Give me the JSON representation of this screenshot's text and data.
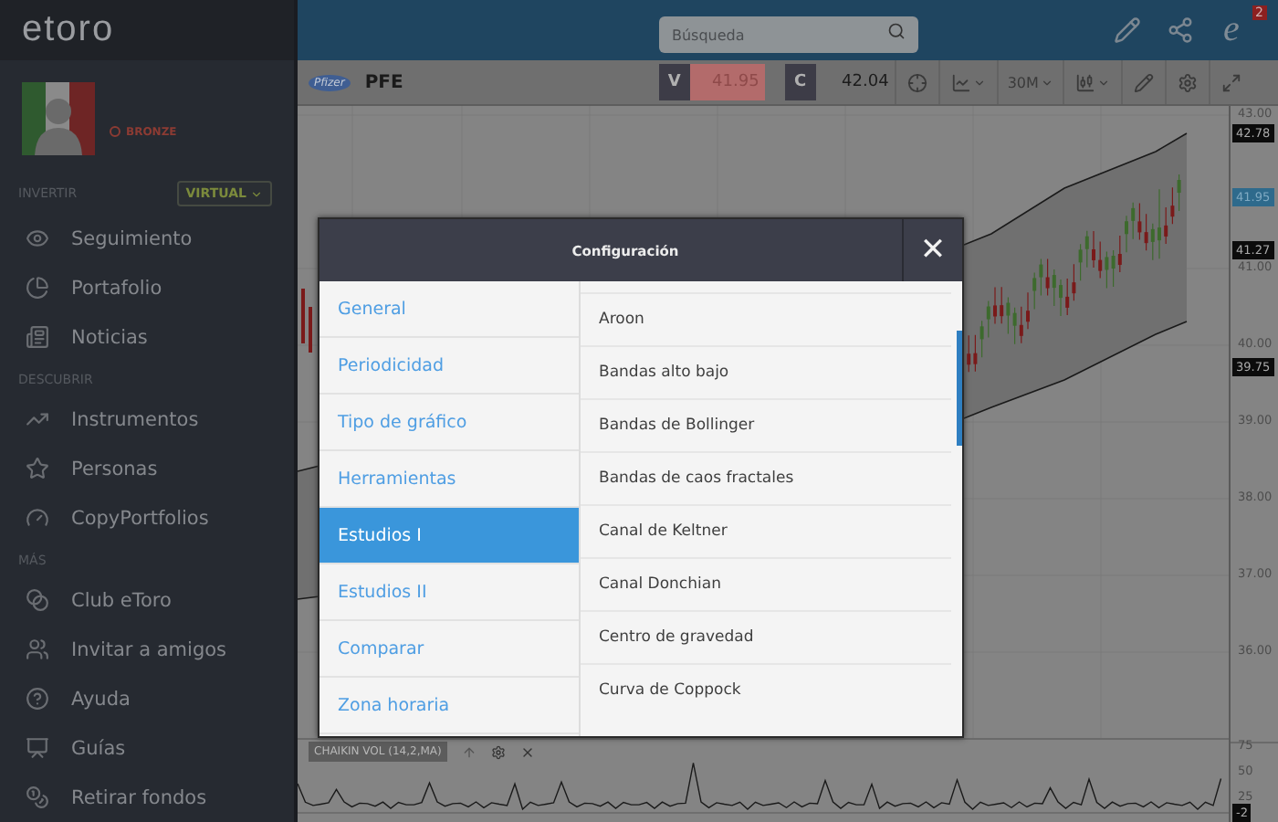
{
  "sidebar": {
    "logo": "etoro",
    "user": {
      "tier": "BRONZE"
    },
    "sections": [
      {
        "title": "INVERTIR",
        "account_mode": "VIRTUAL",
        "items": [
          {
            "label": "Seguimiento",
            "kind": "eye"
          },
          {
            "label": "Portafolio",
            "kind": "pie"
          },
          {
            "label": "Noticias",
            "kind": "news"
          }
        ]
      },
      {
        "title": "DESCUBRIR",
        "items": [
          {
            "label": "Instrumentos",
            "kind": "trend"
          },
          {
            "label": "Personas",
            "kind": "star"
          },
          {
            "label": "CopyPortfolios",
            "kind": "gauge"
          }
        ]
      },
      {
        "title": "MÁS",
        "items": [
          {
            "label": "Club eToro",
            "kind": "club"
          },
          {
            "label": "Invitar a amigos",
            "kind": "users"
          },
          {
            "label": "Ayuda",
            "kind": "help"
          },
          {
            "label": "Guías",
            "kind": "board"
          },
          {
            "label": "Retirar fondos",
            "kind": "coins"
          }
        ]
      }
    ]
  },
  "top_bar": {
    "search": {
      "placeholder": "Búsqueda"
    },
    "notifications": {
      "glyph": "e",
      "count": "2"
    }
  },
  "chart_toolbar": {
    "logo": "Pfizer",
    "symbol": "PFE",
    "sell": {
      "label": "V",
      "price": "41.95"
    },
    "buy": {
      "label": "C",
      "price": "42.04"
    },
    "period": "30M"
  },
  "price_axis": {
    "ticks": [
      "43.00",
      "41.00",
      "40.00",
      "39.00",
      "38.00",
      "37.00",
      "36.00"
    ],
    "badges": [
      {
        "text": "42.78",
        "kind": "band"
      },
      {
        "text": "41.95",
        "kind": "current"
      },
      {
        "text": "41.27",
        "kind": "band"
      },
      {
        "text": "39.75",
        "kind": "band"
      }
    ]
  },
  "indicator": {
    "label": "CHAIKIN VOL (14,2,MA)",
    "ticks": [
      "75",
      "50",
      "25"
    ],
    "badge": "-2"
  },
  "dialog": {
    "title": "Configuración",
    "close": "✕",
    "categories": [
      {
        "label": "General",
        "selected": false
      },
      {
        "label": "Periodicidad",
        "selected": false
      },
      {
        "label": "Tipo de gráfico",
        "selected": false
      },
      {
        "label": "Herramientas",
        "selected": false
      },
      {
        "label": "Estudios I",
        "selected": true
      },
      {
        "label": "Estudios II",
        "selected": false
      },
      {
        "label": "Comparar",
        "selected": false
      },
      {
        "label": "Zona horaria",
        "selected": false
      }
    ],
    "studies": [
      "Aroon",
      "Bandas alto bajo",
      "Bandas de Bollinger",
      "Bandas de caos fractales",
      "Canal de Keltner",
      "Canal Donchian",
      "Centro de gravedad",
      "Curva de Coppock"
    ]
  }
}
